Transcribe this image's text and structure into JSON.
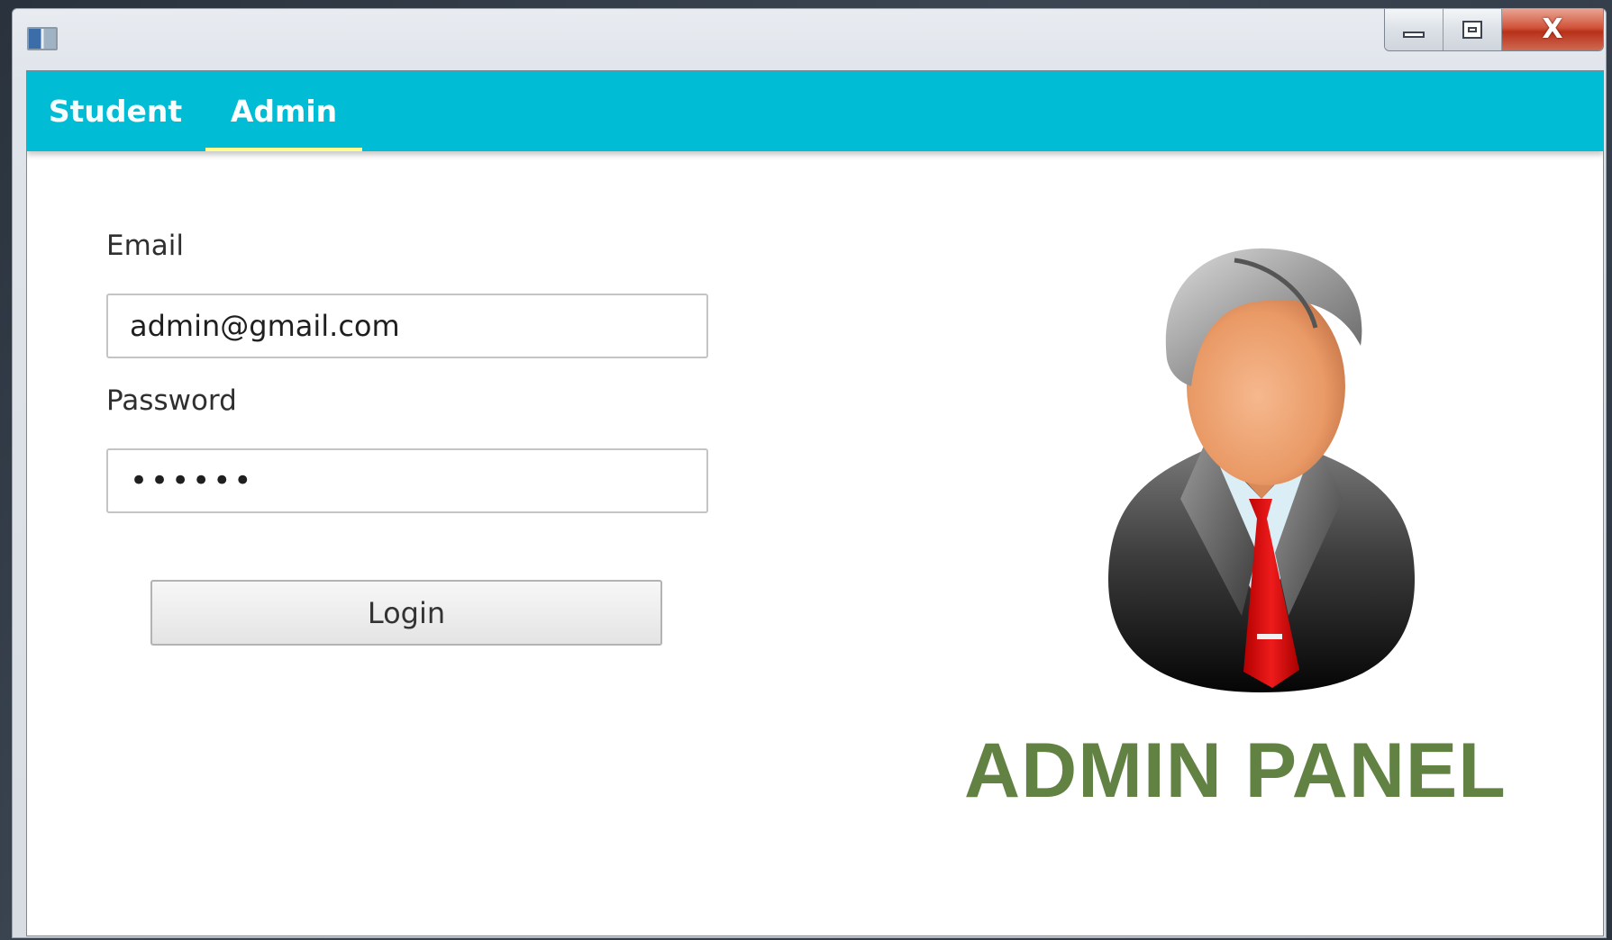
{
  "window": {
    "caption_buttons": {
      "minimize_icon": "minimize-icon",
      "maximize_icon": "maximize-icon",
      "close_label": "X"
    }
  },
  "tabs": [
    {
      "label": "Student",
      "selected": false
    },
    {
      "label": "Admin",
      "selected": true
    }
  ],
  "form": {
    "email_label": "Email",
    "email_value": "admin@gmail.com",
    "password_label": "Password",
    "password_masked": "••••••",
    "login_label": "Login"
  },
  "branding": {
    "avatar_icon": "admin-user-icon",
    "title": "ADMIN PANEL"
  },
  "colors": {
    "tabbar": "#00bcd4",
    "tab_indicator": "#ffff8d",
    "title_green": "#628244",
    "close_red": "#c8412a"
  }
}
